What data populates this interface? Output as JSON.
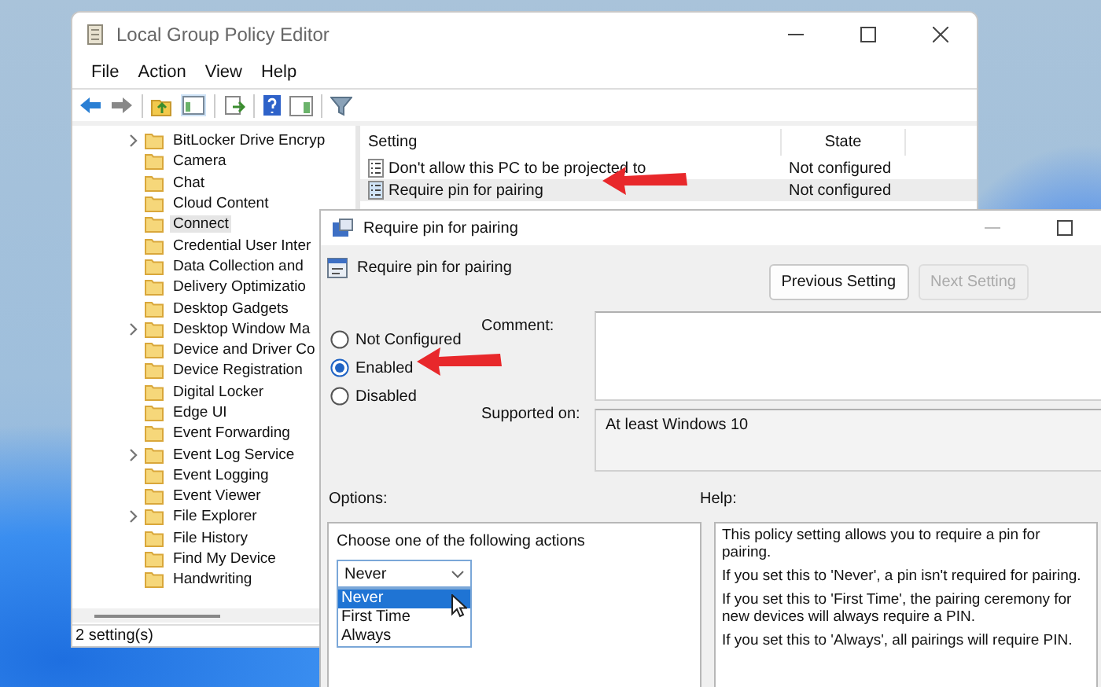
{
  "main_window": {
    "title": "Local Group Policy Editor",
    "menu": [
      "File",
      "Action",
      "View",
      "Help"
    ],
    "tree": [
      {
        "label": "BitLocker Drive Encryp",
        "expandable": true,
        "selected": false
      },
      {
        "label": "Camera",
        "expandable": false,
        "selected": false
      },
      {
        "label": "Chat",
        "expandable": false,
        "selected": false
      },
      {
        "label": "Cloud Content",
        "expandable": false,
        "selected": false
      },
      {
        "label": "Connect",
        "expandable": false,
        "selected": true
      },
      {
        "label": "Credential User Inter",
        "expandable": false,
        "selected": false
      },
      {
        "label": "Data Collection and",
        "expandable": false,
        "selected": false
      },
      {
        "label": "Delivery Optimizatio",
        "expandable": false,
        "selected": false
      },
      {
        "label": "Desktop Gadgets",
        "expandable": false,
        "selected": false
      },
      {
        "label": "Desktop Window Ma",
        "expandable": true,
        "selected": false
      },
      {
        "label": "Device and Driver Co",
        "expandable": false,
        "selected": false
      },
      {
        "label": "Device Registration",
        "expandable": false,
        "selected": false
      },
      {
        "label": "Digital Locker",
        "expandable": false,
        "selected": false
      },
      {
        "label": "Edge UI",
        "expandable": false,
        "selected": false
      },
      {
        "label": "Event Forwarding",
        "expandable": false,
        "selected": false
      },
      {
        "label": "Event Log Service",
        "expandable": true,
        "selected": false
      },
      {
        "label": "Event Logging",
        "expandable": false,
        "selected": false
      },
      {
        "label": "Event Viewer",
        "expandable": false,
        "selected": false
      },
      {
        "label": "File Explorer",
        "expandable": true,
        "selected": false
      },
      {
        "label": "File History",
        "expandable": false,
        "selected": false
      },
      {
        "label": "Find My Device",
        "expandable": false,
        "selected": false
      },
      {
        "label": "Handwriting",
        "expandable": false,
        "selected": false
      }
    ],
    "list": {
      "columns": [
        "Setting",
        "State"
      ],
      "rows": [
        {
          "setting": "Don't allow this PC to be projected to",
          "state": "Not configured",
          "selected": false
        },
        {
          "setting": "Require pin for pairing",
          "state": "Not configured",
          "selected": true
        }
      ]
    },
    "status_bar": "2 setting(s)"
  },
  "dialog": {
    "title": "Require pin for pairing",
    "policy_name": "Require pin for pairing",
    "buttons": [
      {
        "label": "Previous Setting",
        "disabled": false
      },
      {
        "label": "Next Setting",
        "disabled": true
      }
    ],
    "radios": [
      {
        "label": "Not Configured",
        "selected": false
      },
      {
        "label": "Enabled",
        "selected": true
      },
      {
        "label": "Disabled",
        "selected": false
      }
    ],
    "comment_label": "Comment:",
    "supported_label": "Supported on:",
    "supported_value": "At least Windows 10",
    "options_label": "Options:",
    "help_label": "Help:",
    "options": {
      "prompt": "Choose one of the following actions",
      "dropdown": {
        "value": "Never",
        "expanded": true,
        "options": [
          {
            "label": "Never",
            "selected": true
          },
          {
            "label": "First Time",
            "selected": false
          },
          {
            "label": "Always",
            "selected": false
          }
        ]
      }
    },
    "help": [
      "This policy setting allows you to require a pin for pairing.",
      "If you set this to 'Never', a pin isn't required for pairing.",
      "If you set this to 'First Time', the pairing ceremony for new devices will always require a PIN.",
      "If you set this to 'Always', all pairings will require PIN."
    ]
  }
}
